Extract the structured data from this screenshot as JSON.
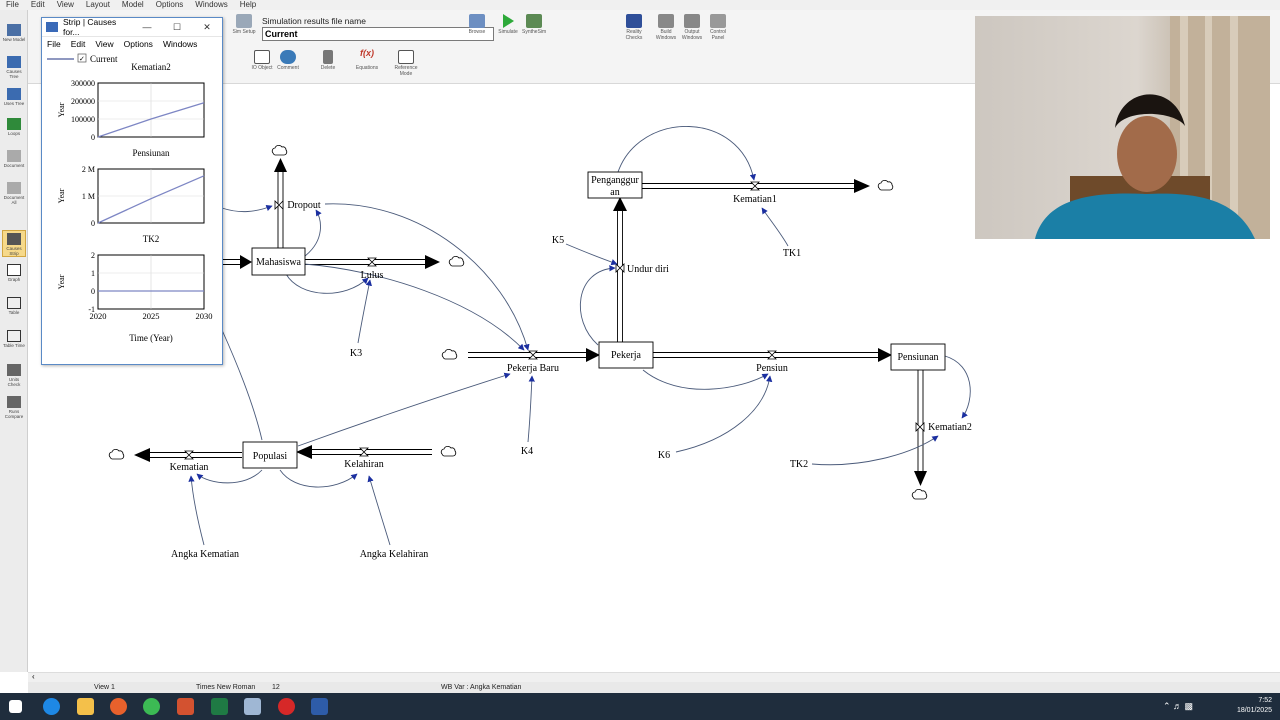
{
  "menubar": [
    "File",
    "Edit",
    "View",
    "Layout",
    "Model",
    "Options",
    "Windows",
    "Help"
  ],
  "toolbar": {
    "sim_label": "Simulation results file name",
    "sim_value": "Current",
    "buttons": {
      "sim_setup": "Sim Setup",
      "browse": "Browse",
      "simulate": "Simulate",
      "synthesim": "SyntheSim",
      "reality_checks": "Reality Checks",
      "build_windows": "Build Windows",
      "output_windows": "Output Windows",
      "control_panel": "Control Panel",
      "io_object": "IO Object",
      "comment": "Comment",
      "delete": "Delete",
      "equations": "Equations",
      "reference_mode": "Reference Mode"
    }
  },
  "left_tools": [
    "New Model",
    "Causes Tree",
    "Uses Tree",
    "Loops",
    "Document",
    "Document All",
    "Causes Strip",
    "Graph",
    "Table",
    "Table Time",
    "Units Check",
    "Runs Compare"
  ],
  "strip_window": {
    "title": "Strip | Causes for...",
    "menu": [
      "File",
      "Edit",
      "View",
      "Options",
      "Windows"
    ],
    "legend": "Current",
    "charts": [
      {
        "title": "Kematian2",
        "unit": "Year",
        "ticks": [
          "300000",
          "200000",
          "100000",
          "0"
        ]
      },
      {
        "title": "Pensiunan",
        "unit": "Year",
        "ticks": [
          "2 M",
          "1 M",
          "0"
        ]
      },
      {
        "title": "TK2",
        "unit": "Year",
        "ticks": [
          "2",
          "1",
          "0",
          "-1"
        ]
      }
    ],
    "x_ticks": [
      "2020",
      "2025",
      "2030"
    ],
    "x_label": "Time (Year)"
  },
  "chart_data": [
    {
      "type": "line",
      "title": "Kematian2",
      "ylabel": "Year",
      "xlabel": "Time (Year)",
      "x": [
        2020,
        2025,
        2030
      ],
      "series": [
        {
          "name": "Current",
          "values": [
            0,
            100000,
            190000
          ]
        }
      ],
      "ylim": [
        0,
        300000
      ]
    },
    {
      "type": "line",
      "title": "Pensiunan",
      "ylabel": "Year",
      "xlabel": "Time (Year)",
      "x": [
        2020,
        2025,
        2030
      ],
      "series": [
        {
          "name": "Current",
          "values": [
            0,
            900000,
            1750000
          ]
        }
      ],
      "ylim": [
        0,
        2000000
      ]
    },
    {
      "type": "line",
      "title": "TK2",
      "ylabel": "Year",
      "xlabel": "Time (Year)",
      "x": [
        2020,
        2025,
        2030
      ],
      "series": [
        {
          "name": "Current",
          "values": [
            0,
            0,
            0
          ]
        }
      ],
      "ylim": [
        -1,
        2
      ]
    }
  ],
  "diagram": {
    "stocks": {
      "mahasiswa": "Mahasiswa",
      "pengangguran_1": "Penganggur",
      "pengangguran_2": "an",
      "pekerja": "Pekerja",
      "pensiunan": "Pensiunan",
      "populasi": "Populasi"
    },
    "flows": {
      "dropout": "Dropout",
      "lulus": "Lulus",
      "kematian1": "Kematian1",
      "undur_diri": "Undur diri",
      "pekerja_baru": "Pekerja Baru",
      "pensiun": "Pensiun",
      "kematian2": "Kematian2",
      "kematian": "Kematian",
      "kelahiran": "Kelahiran"
    },
    "aux": {
      "k3": "K3",
      "k4": "K4",
      "k5": "K5",
      "k6": "K6",
      "tk1": "TK1",
      "tk2": "TK2",
      "angka_kematian": "Angka Kematian",
      "angka_kelahiran": "Angka Kelahiran"
    }
  },
  "status": {
    "view": "View 1",
    "font": "Times New Roman",
    "size": "12",
    "var": "WB Var : Angka Kematian"
  },
  "clock": {
    "time": "7:52",
    "date": "18/01/2025"
  }
}
